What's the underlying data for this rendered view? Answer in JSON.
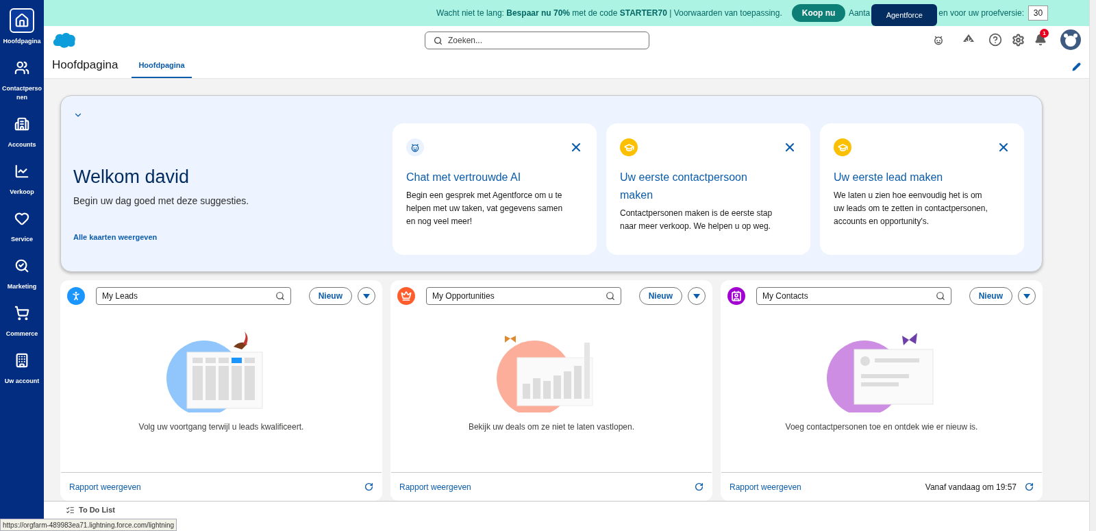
{
  "sidebar": {
    "items": [
      {
        "label": "Hoofdpagina",
        "selected": true,
        "kind": "home"
      },
      {
        "label": "Contactpersonen",
        "selected": false,
        "kind": "contacts"
      },
      {
        "label": "Accounts",
        "selected": false,
        "kind": "accounts"
      },
      {
        "label": "Verkoop",
        "selected": false,
        "kind": "sales"
      },
      {
        "label": "Service",
        "selected": false,
        "kind": "service"
      },
      {
        "label": "Marketing",
        "selected": false,
        "kind": "marketing"
      },
      {
        "label": "Commerce",
        "selected": false,
        "kind": "commerce"
      },
      {
        "label": "Uw account",
        "selected": false,
        "kind": "account"
      }
    ]
  },
  "banner": {
    "message": "Wacht niet te lang: **Bespaar nu 70%** met de code **STARTER70** | Voorwaarden van toepassing.",
    "button": "Koop nu",
    "trial_label_start": "Aanta",
    "trial_label_end": "en voor uw proefversie:",
    "trial_days": "30"
  },
  "tooltip": "Agentforce",
  "header": {
    "search_placeholder": "Zoeken...",
    "notification_count": "1"
  },
  "page": {
    "title": "Hoofdpagina",
    "tabs": [
      {
        "label": "Hoofdpagina",
        "selected": true
      }
    ]
  },
  "welcome": {
    "title": "Welkom david",
    "subtitle": "Begin uw dag goed met deze suggesties.",
    "link": "Alle kaarten weergeven",
    "expanded": true,
    "cards": [
      {
        "kind": "agent",
        "title": "Chat met vertrouwde AI",
        "text": "Begin een gesprek met Agentforce om u te helpen met uw taken, vat gegevens samen en nog veel meer!"
      },
      {
        "kind": "learn",
        "title": "Uw eerste contactpersoon maken",
        "text": "Contactpersonen maken is de eerste stap naar meer verkoop. We helpen u op weg."
      },
      {
        "kind": "learn",
        "title": "Uw eerste lead maken",
        "text": "We laten u zien hoe eenvoudig het is om uw leads om te zetten in contactpersonen, accounts en opportunity's."
      }
    ]
  },
  "lists": [
    {
      "kind": "leads",
      "search": "My Leads",
      "button": "Nieuw",
      "message": "Volg uw voortgang terwijl u leads kwalificeert.",
      "link": "Rapport weergeven"
    },
    {
      "kind": "opportunities",
      "search": "My Opportunities",
      "button": "Nieuw",
      "message": "Bekijk uw deals om ze niet te laten vastlopen.",
      "link": "Rapport weergeven"
    },
    {
      "kind": "contacts",
      "search": "My Contacts",
      "button": "Nieuw",
      "message": "Voeg contactpersonen toe en ontdek wie er nieuw is.",
      "link": "Rapport weergeven",
      "timestamp": "Vanaf vandaag om 19:57"
    }
  ],
  "utility_bar": {
    "item": "To Do List"
  },
  "status_url": "https://orgfarm-489983ea71.lightning.force.com/lightning"
}
